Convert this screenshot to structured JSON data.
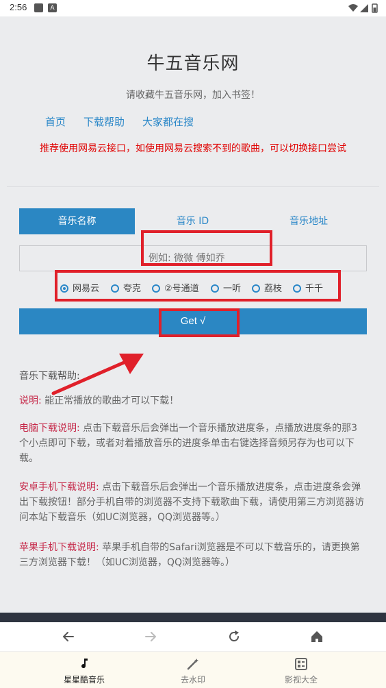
{
  "status_bar": {
    "time": "2:56"
  },
  "site": {
    "title": "牛五音乐网",
    "subtitle": "请收藏牛五音乐网，加入书签！",
    "nav_links": [
      "首页",
      "下载帮助",
      "大家都在搜"
    ],
    "notice": "推荐使用网易云接口，如使用网易云搜索不到的歌曲，可以切换接口尝试"
  },
  "tabs": [
    {
      "label": "音乐名称",
      "active": true
    },
    {
      "label": "音乐 ID",
      "active": false
    },
    {
      "label": "音乐地址",
      "active": false
    }
  ],
  "search": {
    "placeholder": "例如: 微微 傅如乔"
  },
  "sources": [
    {
      "label": "网易云",
      "checked": true
    },
    {
      "label": "夸克",
      "checked": false
    },
    {
      "label": "②号通道",
      "checked": false
    },
    {
      "label": "一听",
      "checked": false
    },
    {
      "label": "荔枝",
      "checked": false
    },
    {
      "label": "千千",
      "checked": false
    }
  ],
  "get_button": {
    "label": "Get √"
  },
  "help": {
    "title": "音乐下载帮助:",
    "items": [
      {
        "label": "说明:",
        "text": "能正常播放的歌曲才可以下载！"
      },
      {
        "label": "电脑下载说明:",
        "text": "点击下载音乐后会弹出一个音乐播放进度条，点播放进度条的那3个小点即可下载，或者对着播放音乐的进度条单击右键选择音频另存为也可以下载。"
      },
      {
        "label": "安卓手机下载说明:",
        "text": "点击下载音乐后会弹出一个音乐播放进度条，点击进度条会弹出下载按钮！部分手机自带的浏览器不支持下载歌曲下载，请使用第三方浏览器访问本站下载音乐（如UC浏览器，QQ浏览器等。）"
      },
      {
        "label": "苹果手机下载说明:",
        "text": "苹果手机自带的Safari浏览器是不可以下载音乐的，请更换第三方浏览器下载！（如UC浏览器，QQ浏览器等。）"
      }
    ]
  },
  "bottom_nav": [
    {
      "label": "星星酷音乐",
      "icon": "music-note-icon",
      "active": true
    },
    {
      "label": "去水印",
      "icon": "magic-wand-icon",
      "active": false
    },
    {
      "label": "影视大全",
      "icon": "list-card-icon",
      "active": false
    }
  ],
  "colors": {
    "accent": "#2b87c3",
    "notice": "#e00000",
    "label": "#c62a4a",
    "highlight": "#e0202a"
  }
}
